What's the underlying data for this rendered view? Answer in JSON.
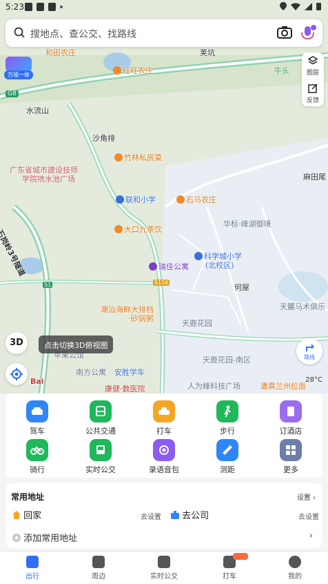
{
  "status": {
    "time": "5:23"
  },
  "search": {
    "placeholder": "搜地点、查公交、找路线"
  },
  "tools": {
    "layers": "图层",
    "feedback": "反馈"
  },
  "wanchao": {
    "label": "万境一体"
  },
  "map_labels": {
    "hetian_farm": "和田农庄",
    "yingkeng": "荚坑",
    "wangwang_farm": "旺旺农庄",
    "niu": "牛头",
    "g": "G8",
    "shuiliushan": "水流山",
    "shajiaopai": "沙角排",
    "zhulin": "竹林私房菜",
    "school1": "广东省城市建设技师",
    "school2": "学院喷水池广场",
    "matianwei": "麻田尾",
    "lianhe": "联和小学",
    "shima": "石马农庄",
    "tunnel": "石岗岭3号隧道",
    "dakou": "大口九茶饮",
    "huahua": "华标·峰湖御境",
    "kexuecheng1": "科学城小学",
    "kexuecheng2": "(北校区)",
    "ruijia": "瑞佳公寓",
    "s116": "S116",
    "s1": "S1",
    "hewu": "何屋",
    "chaozhou1": "潮汕海鲜大排档",
    "chaozhou2": "·砂锅粥",
    "tianlu": "天鹿花园",
    "tianma": "天麓马术俱乐",
    "pingguo": "苹果公馆",
    "tianlu_south": "天鹿花园-南区",
    "nanfang": "南方公寓",
    "ansheng": "安胜学车",
    "renwei": "人为峰科技广场",
    "lanzhou": "遭真兰州拉面",
    "kang": "康健·数医院",
    "bai": "Bai"
  },
  "map_buttons": {
    "btn3d": "3D",
    "tip3d": "点击切换3D俯视图",
    "route": "路线",
    "weather": "28°C"
  },
  "grid": [
    {
      "label": "驾车",
      "color": "#2f86f6"
    },
    {
      "label": "公共交通",
      "color": "#1fb85a"
    },
    {
      "label": "打车",
      "color": "#f5a623"
    },
    {
      "label": "步行",
      "color": "#1fb85a"
    },
    {
      "label": "订酒店",
      "color": "#9b6cf0"
    },
    {
      "label": "骑行",
      "color": "#1fb85a"
    },
    {
      "label": "实时公交",
      "color": "#1fb85a"
    },
    {
      "label": "录语音包",
      "color": "#8a5cf0"
    },
    {
      "label": "测距",
      "color": "#2f86f6"
    },
    {
      "label": "更多",
      "color": "#6b7fa8"
    }
  ],
  "places": {
    "title": "常用地址",
    "settings": "设置",
    "home": "回家",
    "home_set": "去设置",
    "work": "去公司",
    "work_set": "去设置",
    "add": "添加常用地址"
  },
  "nav": [
    {
      "label": "出行",
      "active": true
    },
    {
      "label": "周边",
      "active": false
    },
    {
      "label": "实时公交",
      "active": false
    },
    {
      "label": "打车",
      "active": false
    },
    {
      "label": "我的",
      "active": false
    }
  ]
}
